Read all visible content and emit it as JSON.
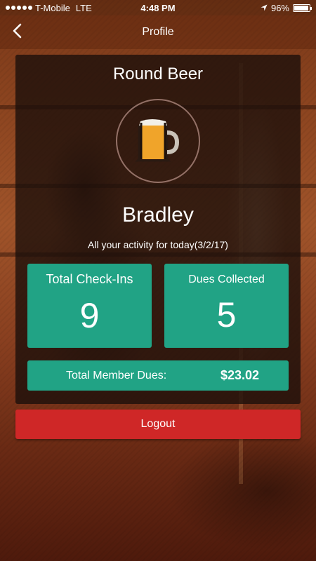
{
  "status_bar": {
    "carrier": "T-Mobile",
    "network": "LTE",
    "time": "4:48 PM",
    "battery_text": "96%",
    "battery_level": 0.96,
    "icons": [
      "signal-dots-icon",
      "location-arrow-icon",
      "battery-icon"
    ]
  },
  "nav": {
    "title": "Profile",
    "back_icon": "chevron-left-icon"
  },
  "profile": {
    "org_name": "Round Beer",
    "logo_icon": "beer-mug-icon",
    "user_name": "Bradley",
    "activity_text": "All your activity for today(3/2/17)"
  },
  "stats": {
    "checkins_label": "Total Check-Ins",
    "checkins_value": "9",
    "dues_collected_label": "Dues Collected",
    "dues_collected_value": "5"
  },
  "dues": {
    "label": "Total Member Dues:",
    "amount": "$23.02"
  },
  "actions": {
    "logout_label": "Logout"
  },
  "colors": {
    "accent_green": "#21a385",
    "logout_red": "#cf2727"
  }
}
